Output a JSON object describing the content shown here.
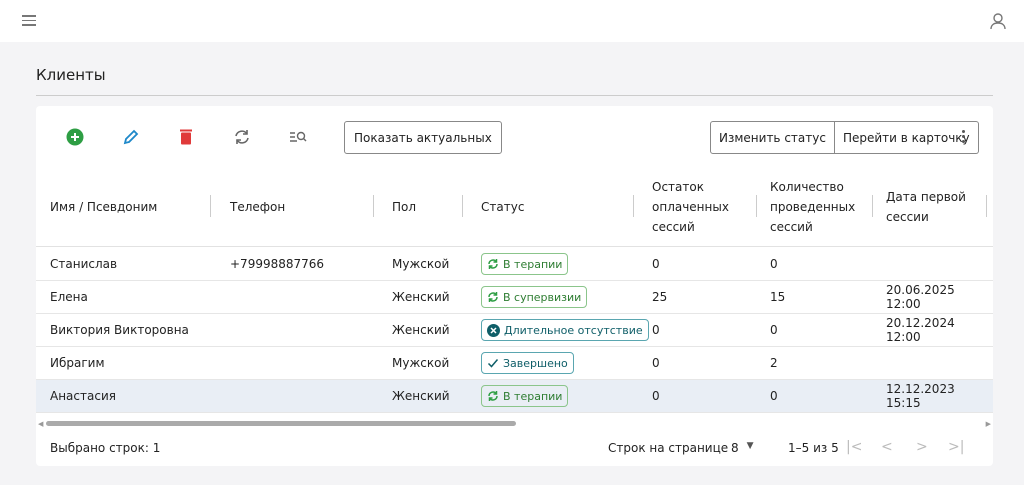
{
  "page": {
    "title": "Клиенты"
  },
  "toolbar": {
    "show_current": "Показать актуальных",
    "change_status": "Изменить статус",
    "go_to_card": "Перейти в карточку"
  },
  "columns": [
    "Имя / Псевдоним",
    "Телефон",
    "Пол",
    "Статус",
    "Остаток оплаченных сессий",
    "Количество проведенных сессий",
    "Дата первой сессии"
  ],
  "rows": [
    {
      "name": "Станислав",
      "phone": "+79998887766",
      "gender": "Мужской",
      "status": "В терапии",
      "remain": "0",
      "count": "0",
      "date": ""
    },
    {
      "name": "Елена",
      "phone": "",
      "gender": "Женский",
      "status": "В супервизии",
      "remain": "25",
      "count": "15",
      "date": "20.06.2025 12:00"
    },
    {
      "name": "Виктория Викторовна",
      "phone": "",
      "gender": "Женский",
      "status": "Длительное отсутствие",
      "remain": "0",
      "count": "0",
      "date": "20.12.2024 12:00"
    },
    {
      "name": "Ибрагим",
      "phone": "",
      "gender": "Мужской",
      "status": "Завершено",
      "remain": "0",
      "count": "2",
      "date": ""
    },
    {
      "name": "Анастасия",
      "phone": "",
      "gender": "Женский",
      "status": "В терапии",
      "remain": "0",
      "count": "0",
      "date": "12.12.2023 15:15"
    }
  ],
  "footer": {
    "selected": "Выбрано строк: 1",
    "rows_per_page_label": "Строк на странице",
    "rows_per_page": "8",
    "range": "1–5 из 5"
  },
  "colors": {
    "add": "#2e9e44",
    "edit": "#1e88c9",
    "delete": "#e03a3a",
    "chip_green": "#2e7d32",
    "chip_teal": "#0f5e68"
  }
}
